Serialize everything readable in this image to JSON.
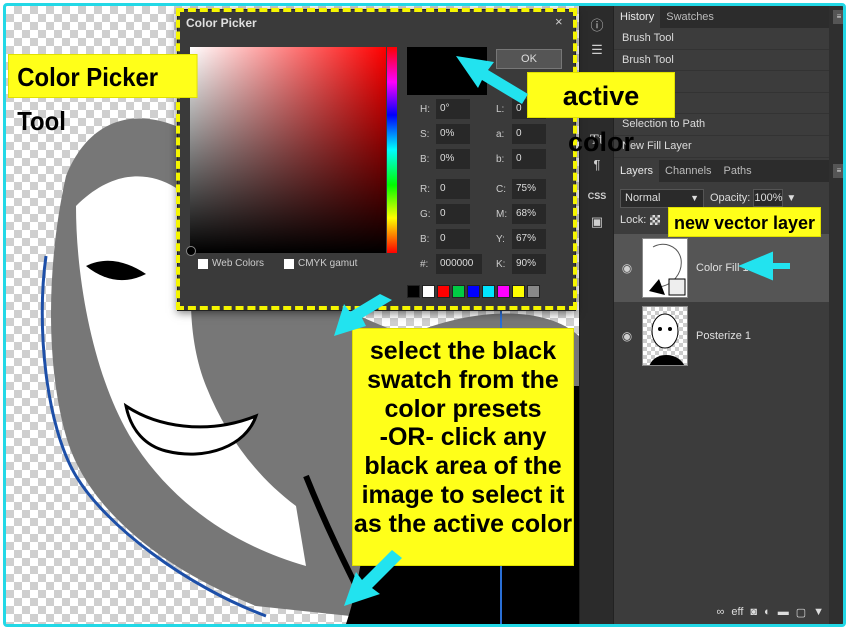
{
  "dialog": {
    "title": "Color Picker",
    "ok_label": "OK",
    "fields_left": [
      {
        "label": "H:",
        "value": "0°"
      },
      {
        "label": "S:",
        "value": "0%"
      },
      {
        "label": "B:",
        "value": "0%"
      },
      {
        "label": "R:",
        "value": "0"
      },
      {
        "label": "G:",
        "value": "0"
      },
      {
        "label": "B:",
        "value": "0"
      },
      {
        "label": "#:",
        "value": "000000"
      }
    ],
    "fields_right": [
      {
        "label": "L:",
        "value": "0"
      },
      {
        "label": "a:",
        "value": "0"
      },
      {
        "label": "b:",
        "value": "0"
      },
      {
        "label": "C:",
        "value": "75%"
      },
      {
        "label": "M:",
        "value": "68%"
      },
      {
        "label": "Y:",
        "value": "67%"
      },
      {
        "label": "K:",
        "value": "90%"
      }
    ],
    "web_colors_label": "Web Colors",
    "cmyk_label": "CMYK gamut",
    "active_color": "#000000",
    "swatch_colors": [
      "#000000",
      "#ffffff",
      "#ff0000",
      "#00cc44",
      "#0000ff",
      "#00e5ff",
      "#ff00ff",
      "#ffff00",
      "#888888"
    ]
  },
  "history": {
    "tabs": [
      "History",
      "Swatches"
    ],
    "items": [
      "Brush Tool",
      "Brush Tool",
      "Brush Tool",
      "Brush Tool",
      "Selection to Path",
      "New Fill Layer"
    ]
  },
  "layers": {
    "tabs": [
      "Layers",
      "Channels",
      "Paths"
    ],
    "blend_mode": "Normal",
    "opacity_label": "Opacity:",
    "opacity_value": "100%",
    "lock_label": "Lock:",
    "items": [
      {
        "name": "Color Fill 1"
      },
      {
        "name": "Posterize 1"
      }
    ],
    "bottom_icons": "eff"
  },
  "callouts": {
    "tool": "Color Picker Tool",
    "active": "active color",
    "vector": "new vector layer",
    "instructions": [
      "select the black",
      "swatch from the",
      "color presets",
      "-OR- click any",
      "black area of the",
      "image to select it",
      "as the active color"
    ]
  },
  "colors": {
    "accent": "#22d8e6",
    "highlight": "#ffff19"
  }
}
